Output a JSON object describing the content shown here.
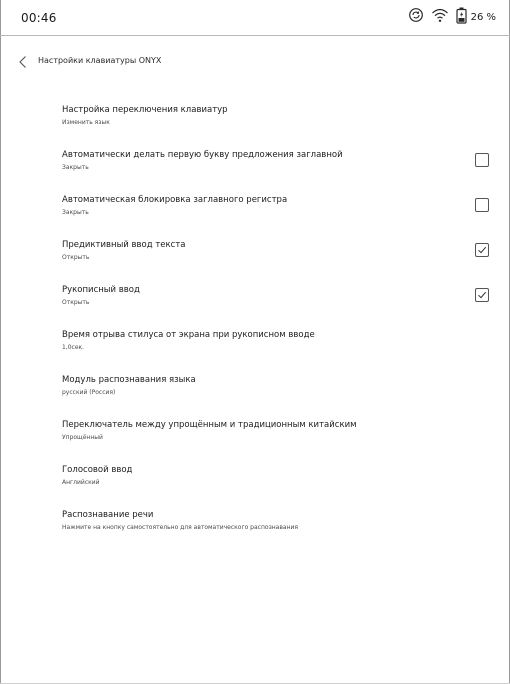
{
  "status_bar": {
    "time": "00:46",
    "battery_percent": "26 %",
    "icons": [
      "sync-icon",
      "wifi-icon",
      "battery-charging-icon"
    ]
  },
  "header": {
    "title": "Настройки клавиатуры ONYX",
    "back_icon": "chevron-left-icon"
  },
  "settings": [
    {
      "title": "Настройка переключения клавиатур",
      "subtitle": "Изменить язык"
    },
    {
      "title": "Автоматически делать первую букву предложения заглавной",
      "subtitle": "Закрыть",
      "checkbox": false
    },
    {
      "title": "Автоматическая блокировка заглавного регистра",
      "subtitle": "Закрыть",
      "checkbox": false
    },
    {
      "title": "Предиктивный ввод текста",
      "subtitle": "Открыть",
      "checkbox": true
    },
    {
      "title": "Рукописный ввод",
      "subtitle": "Открыть",
      "checkbox": true
    },
    {
      "title": "Время отрыва стилуса от экрана при рукописном вводе",
      "subtitle": "1,0сек."
    },
    {
      "title": "Модуль распознавания языка",
      "subtitle": "русский (Россия)"
    },
    {
      "title": "Переключатель между упрощённым и традиционным китайским",
      "subtitle": "Упрощённый"
    },
    {
      "title": "Голосовой ввод",
      "subtitle": "Английский"
    },
    {
      "title": "Распознавание речи",
      "subtitle": "Нажмите на кнопку самостоятельно для автоматического распознавания"
    }
  ]
}
